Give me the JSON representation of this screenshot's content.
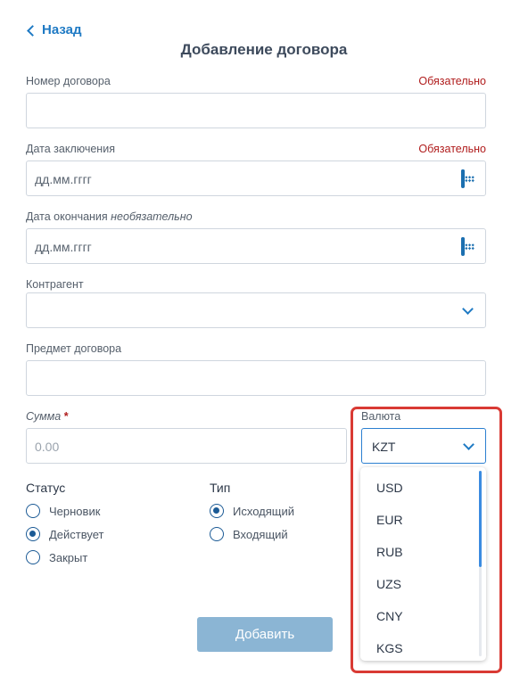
{
  "nav": {
    "back_label": "Назад"
  },
  "page": {
    "title": "Добавление договора"
  },
  "fields": {
    "contract_number": {
      "label": "Номер договора",
      "required_label": "Обязательно",
      "value": ""
    },
    "conclusion_date": {
      "label": "Дата заключения",
      "required_label": "Обязательно",
      "placeholder": "дд.мм.гггг"
    },
    "end_date": {
      "label": "Дата окончания",
      "optional_label": "необязательно",
      "placeholder": "дд.мм.гггг"
    },
    "counterparty": {
      "label": "Контрагент",
      "value": ""
    },
    "subject": {
      "label": "Предмет договора",
      "value": ""
    },
    "amount": {
      "label": "Сумма",
      "required_mark": "*",
      "placeholder": "0.00"
    },
    "currency": {
      "label": "Валюта",
      "selected": "KZT",
      "options": [
        "USD",
        "EUR",
        "RUB",
        "UZS",
        "CNY",
        "KGS"
      ]
    }
  },
  "status": {
    "title": "Статус",
    "options": [
      {
        "label": "Черновик",
        "checked": false
      },
      {
        "label": "Действует",
        "checked": true
      },
      {
        "label": "Закрыт",
        "checked": false
      }
    ]
  },
  "type": {
    "title": "Тип",
    "options": [
      {
        "label": "Исходящий",
        "checked": true
      },
      {
        "label": "Входящий",
        "checked": false
      }
    ]
  },
  "actions": {
    "submit_label": "Добавить"
  },
  "colors": {
    "accent": "#1f7ac4",
    "required": "#b01c1c",
    "button_disabled": "#8bb5d4",
    "highlight": "#d93a34"
  }
}
